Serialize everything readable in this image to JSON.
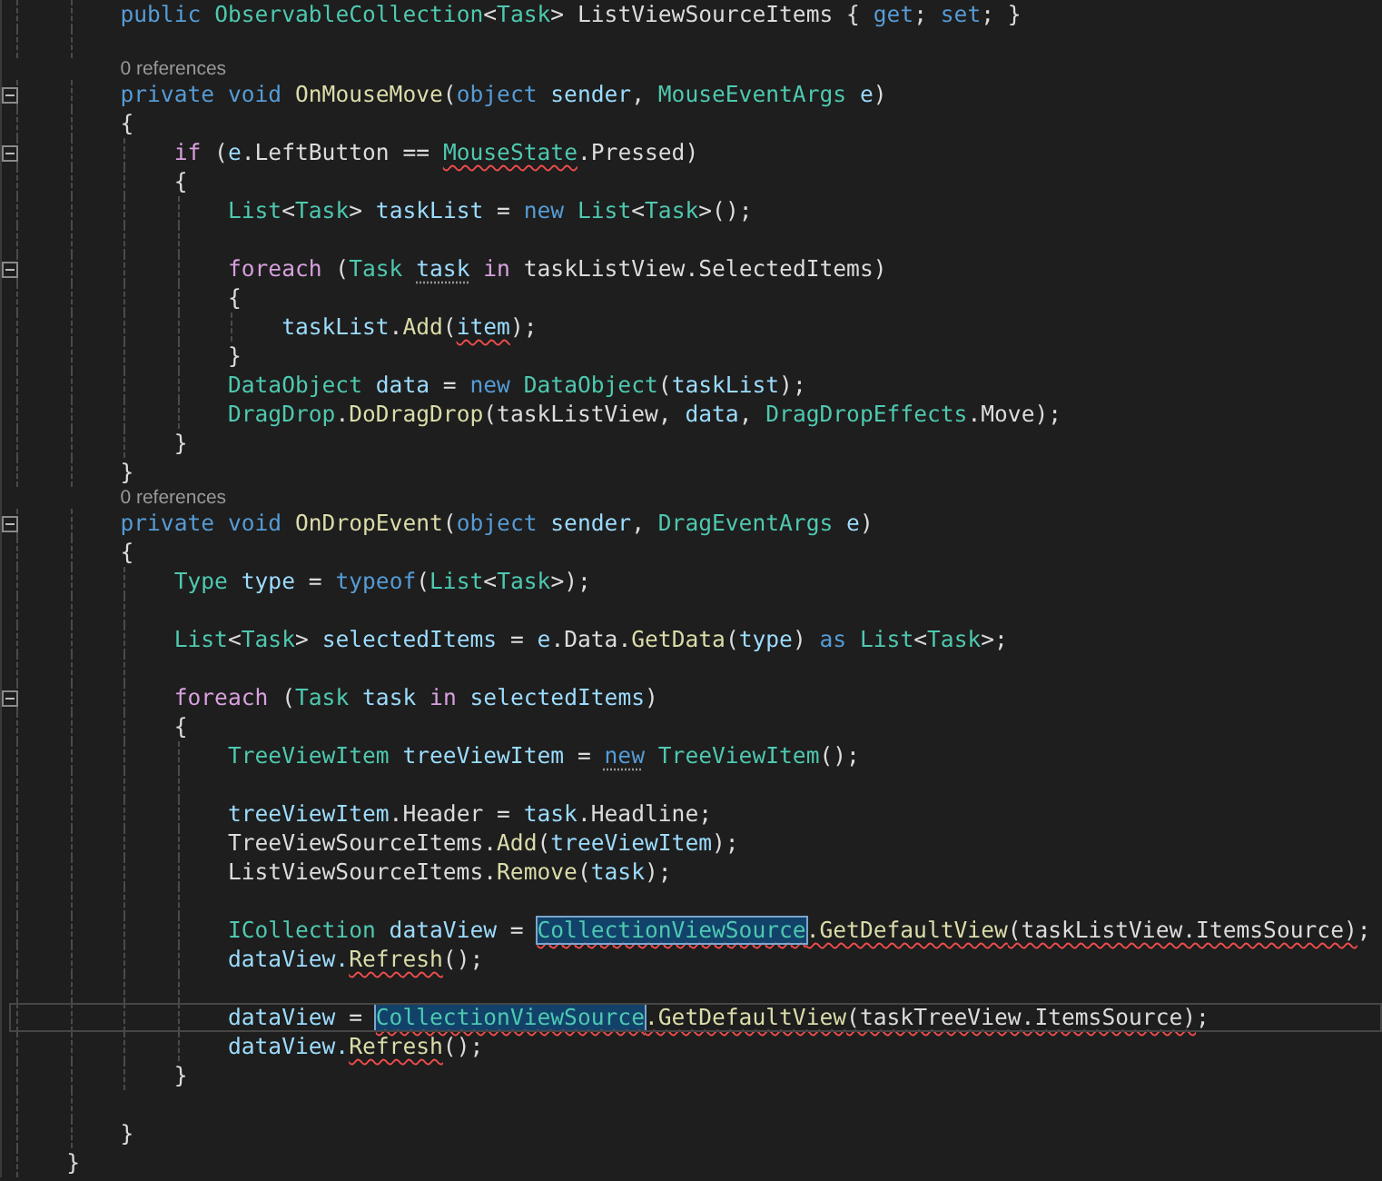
{
  "editor": {
    "lines": [
      {
        "kind": "code",
        "fold": false,
        "current": false,
        "tokens": [
          {
            "text": "        public ",
            "kind": "keyword"
          },
          {
            "text": "ObservableCollection",
            "kind": "type"
          },
          {
            "text": "<",
            "kind": "plain"
          },
          {
            "text": "Task",
            "kind": "type"
          },
          {
            "text": "> ListViewSourceItems { ",
            "kind": "plain"
          },
          {
            "text": "get",
            "kind": "keyword"
          },
          {
            "text": "; ",
            "kind": "plain"
          },
          {
            "text": "set",
            "kind": "keyword"
          },
          {
            "text": "; }",
            "kind": "plain"
          }
        ]
      },
      {
        "kind": "blank"
      },
      {
        "kind": "codelens",
        "text": "0 references"
      },
      {
        "kind": "code",
        "fold": true,
        "current": false,
        "tokens": [
          {
            "text": "        private void ",
            "kind": "keyword"
          },
          {
            "text": "OnMouseMove",
            "kind": "method"
          },
          {
            "text": "(",
            "kind": "plain"
          },
          {
            "text": "object ",
            "kind": "keyword"
          },
          {
            "text": "sender",
            "kind": "variable"
          },
          {
            "text": ", ",
            "kind": "plain"
          },
          {
            "text": "MouseEventArgs ",
            "kind": "type"
          },
          {
            "text": "e",
            "kind": "variable"
          },
          {
            "text": ")",
            "kind": "plain"
          }
        ]
      },
      {
        "kind": "code",
        "fold": false,
        "current": false,
        "tokens": [
          {
            "text": "        {",
            "kind": "plain"
          }
        ]
      },
      {
        "kind": "code",
        "fold": true,
        "current": false,
        "tokens": [
          {
            "text": "            if",
            "kind": "control"
          },
          {
            "text": " (",
            "kind": "plain"
          },
          {
            "text": "e",
            "kind": "variable"
          },
          {
            "text": ".LeftButton == ",
            "kind": "plain"
          },
          {
            "text": "MouseState",
            "kind": "type-error"
          },
          {
            "text": ".Pressed)",
            "kind": "plain"
          }
        ]
      },
      {
        "kind": "code",
        "fold": false,
        "current": false,
        "tokens": [
          {
            "text": "            {",
            "kind": "plain"
          }
        ]
      },
      {
        "kind": "code",
        "fold": false,
        "current": false,
        "tokens": [
          {
            "text": "                List",
            "kind": "type"
          },
          {
            "text": "<",
            "kind": "plain"
          },
          {
            "text": "Task",
            "kind": "type"
          },
          {
            "text": "> ",
            "kind": "plain"
          },
          {
            "text": "taskList",
            "kind": "variable"
          },
          {
            "text": " = ",
            "kind": "plain"
          },
          {
            "text": "new ",
            "kind": "keyword"
          },
          {
            "text": "List",
            "kind": "type"
          },
          {
            "text": "<",
            "kind": "plain"
          },
          {
            "text": "Task",
            "kind": "type"
          },
          {
            "text": ">();",
            "kind": "plain"
          }
        ]
      },
      {
        "kind": "blank"
      },
      {
        "kind": "code",
        "fold": true,
        "current": false,
        "tokens": [
          {
            "text": "                foreach",
            "kind": "control"
          },
          {
            "text": " (",
            "kind": "plain"
          },
          {
            "text": "Task ",
            "kind": "type"
          },
          {
            "text": "task",
            "kind": "variable-hint"
          },
          {
            "text": " in",
            "kind": "control"
          },
          {
            "text": " taskListView.SelectedItems)",
            "kind": "plain"
          }
        ]
      },
      {
        "kind": "code",
        "fold": false,
        "current": false,
        "tokens": [
          {
            "text": "                {",
            "kind": "plain"
          }
        ]
      },
      {
        "kind": "code",
        "fold": false,
        "current": false,
        "tokens": [
          {
            "text": "                    taskList",
            "kind": "variable"
          },
          {
            "text": ".",
            "kind": "plain"
          },
          {
            "text": "Add",
            "kind": "method"
          },
          {
            "text": "(",
            "kind": "plain"
          },
          {
            "text": "item",
            "kind": "variable-error"
          },
          {
            "text": ");",
            "kind": "plain"
          }
        ]
      },
      {
        "kind": "code",
        "fold": false,
        "current": false,
        "tokens": [
          {
            "text": "                }",
            "kind": "plain"
          }
        ]
      },
      {
        "kind": "code",
        "fold": false,
        "current": false,
        "tokens": [
          {
            "text": "                DataObject ",
            "kind": "type"
          },
          {
            "text": "data",
            "kind": "variable"
          },
          {
            "text": " = ",
            "kind": "plain"
          },
          {
            "text": "new ",
            "kind": "keyword"
          },
          {
            "text": "DataObject",
            "kind": "type"
          },
          {
            "text": "(",
            "kind": "plain"
          },
          {
            "text": "taskList",
            "kind": "variable"
          },
          {
            "text": ");",
            "kind": "plain"
          }
        ]
      },
      {
        "kind": "code",
        "fold": false,
        "current": false,
        "tokens": [
          {
            "text": "                DragDrop",
            "kind": "type"
          },
          {
            "text": ".",
            "kind": "plain"
          },
          {
            "text": "DoDragDrop",
            "kind": "method"
          },
          {
            "text": "(taskListView, ",
            "kind": "plain"
          },
          {
            "text": "data",
            "kind": "variable"
          },
          {
            "text": ", ",
            "kind": "plain"
          },
          {
            "text": "DragDropEffects",
            "kind": "type"
          },
          {
            "text": ".Move);",
            "kind": "plain"
          }
        ]
      },
      {
        "kind": "code",
        "fold": false,
        "current": false,
        "tokens": [
          {
            "text": "            }",
            "kind": "plain"
          }
        ]
      },
      {
        "kind": "code",
        "fold": false,
        "current": false,
        "tokens": [
          {
            "text": "        }",
            "kind": "plain"
          }
        ]
      },
      {
        "kind": "codelens",
        "text": "0 references"
      },
      {
        "kind": "code",
        "fold": true,
        "current": false,
        "tokens": [
          {
            "text": "        private void ",
            "kind": "keyword"
          },
          {
            "text": "OnDropEvent",
            "kind": "method"
          },
          {
            "text": "(",
            "kind": "plain"
          },
          {
            "text": "object ",
            "kind": "keyword"
          },
          {
            "text": "sender",
            "kind": "variable"
          },
          {
            "text": ", ",
            "kind": "plain"
          },
          {
            "text": "DragEventArgs ",
            "kind": "type"
          },
          {
            "text": "e",
            "kind": "variable"
          },
          {
            "text": ")",
            "kind": "plain"
          }
        ]
      },
      {
        "kind": "code",
        "fold": false,
        "current": false,
        "tokens": [
          {
            "text": "        {",
            "kind": "plain"
          }
        ]
      },
      {
        "kind": "code",
        "fold": false,
        "current": false,
        "tokens": [
          {
            "text": "            Type ",
            "kind": "type"
          },
          {
            "text": "type",
            "kind": "variable"
          },
          {
            "text": " = ",
            "kind": "plain"
          },
          {
            "text": "typeof",
            "kind": "keyword"
          },
          {
            "text": "(",
            "kind": "plain"
          },
          {
            "text": "List",
            "kind": "type"
          },
          {
            "text": "<",
            "kind": "plain"
          },
          {
            "text": "Task",
            "kind": "type"
          },
          {
            "text": ">);",
            "kind": "plain"
          }
        ]
      },
      {
        "kind": "blank"
      },
      {
        "kind": "code",
        "fold": false,
        "current": false,
        "tokens": [
          {
            "text": "            List",
            "kind": "type"
          },
          {
            "text": "<",
            "kind": "plain"
          },
          {
            "text": "Task",
            "kind": "type"
          },
          {
            "text": "> ",
            "kind": "plain"
          },
          {
            "text": "selectedItems",
            "kind": "variable"
          },
          {
            "text": " = ",
            "kind": "plain"
          },
          {
            "text": "e",
            "kind": "variable"
          },
          {
            "text": ".Data.",
            "kind": "plain"
          },
          {
            "text": "GetData",
            "kind": "method"
          },
          {
            "text": "(",
            "kind": "plain"
          },
          {
            "text": "type",
            "kind": "variable"
          },
          {
            "text": ") ",
            "kind": "plain"
          },
          {
            "text": "as ",
            "kind": "keyword"
          },
          {
            "text": "List",
            "kind": "type"
          },
          {
            "text": "<",
            "kind": "plain"
          },
          {
            "text": "Task",
            "kind": "type"
          },
          {
            "text": ">;",
            "kind": "plain"
          }
        ]
      },
      {
        "kind": "blank"
      },
      {
        "kind": "code",
        "fold": true,
        "current": false,
        "tokens": [
          {
            "text": "            foreach",
            "kind": "control"
          },
          {
            "text": " (",
            "kind": "plain"
          },
          {
            "text": "Task ",
            "kind": "type"
          },
          {
            "text": "task",
            "kind": "variable"
          },
          {
            "text": " in ",
            "kind": "control"
          },
          {
            "text": "selectedItems",
            "kind": "variable"
          },
          {
            "text": ")",
            "kind": "plain"
          }
        ]
      },
      {
        "kind": "code",
        "fold": false,
        "current": false,
        "tokens": [
          {
            "text": "            {",
            "kind": "plain"
          }
        ]
      },
      {
        "kind": "code",
        "fold": false,
        "current": false,
        "tokens": [
          {
            "text": "                TreeViewItem ",
            "kind": "type"
          },
          {
            "text": "treeViewItem",
            "kind": "variable"
          },
          {
            "text": " = ",
            "kind": "plain"
          },
          {
            "text": "new",
            "kind": "keyword-hint"
          },
          {
            "text": " TreeViewItem",
            "kind": "type"
          },
          {
            "text": "();",
            "kind": "plain"
          }
        ]
      },
      {
        "kind": "blank"
      },
      {
        "kind": "code",
        "fold": false,
        "current": false,
        "tokens": [
          {
            "text": "                treeViewItem",
            "kind": "variable"
          },
          {
            "text": ".Header = ",
            "kind": "plain"
          },
          {
            "text": "task",
            "kind": "variable"
          },
          {
            "text": ".Headline;",
            "kind": "plain"
          }
        ]
      },
      {
        "kind": "code",
        "fold": false,
        "current": false,
        "tokens": [
          {
            "text": "                TreeViewSourceItems.",
            "kind": "plain"
          },
          {
            "text": "Add",
            "kind": "method"
          },
          {
            "text": "(",
            "kind": "plain"
          },
          {
            "text": "treeViewItem",
            "kind": "variable"
          },
          {
            "text": ");",
            "kind": "plain"
          }
        ]
      },
      {
        "kind": "code",
        "fold": false,
        "current": false,
        "tokens": [
          {
            "text": "                ListViewSourceItems.",
            "kind": "plain"
          },
          {
            "text": "Remove",
            "kind": "method"
          },
          {
            "text": "(",
            "kind": "plain"
          },
          {
            "text": "task",
            "kind": "variable"
          },
          {
            "text": ");",
            "kind": "plain"
          }
        ]
      },
      {
        "kind": "blank"
      },
      {
        "kind": "code",
        "fold": false,
        "current": false,
        "tokens": [
          {
            "text": "                ICollection ",
            "kind": "type"
          },
          {
            "text": "dataView",
            "kind": "variable"
          },
          {
            "text": " = ",
            "kind": "plain"
          },
          {
            "text": "CollectionViewSource",
            "kind": "type-highlight-error"
          },
          {
            "text": ".GetDefaultView",
            "kind": "method-error"
          },
          {
            "text": "(taskListView.ItemsSource)",
            "kind": "plain-error"
          },
          {
            "text": ";",
            "kind": "plain"
          }
        ]
      },
      {
        "kind": "code",
        "fold": false,
        "current": false,
        "tokens": [
          {
            "text": "                dataView.",
            "kind": "variable"
          },
          {
            "text": "Refresh",
            "kind": "method-error"
          },
          {
            "text": "();",
            "kind": "plain"
          }
        ]
      },
      {
        "kind": "blank"
      },
      {
        "kind": "code",
        "fold": false,
        "current": true,
        "tokens": [
          {
            "text": "                dataView",
            "kind": "variable"
          },
          {
            "text": " = ",
            "kind": "plain"
          },
          {
            "text": "CollectionViewSource",
            "kind": "type-highlight-error"
          },
          {
            "text": ".GetDefaultView",
            "kind": "method-error"
          },
          {
            "text": "(taskTreeView.ItemsSource)",
            "kind": "plain-error"
          },
          {
            "text": ";",
            "kind": "plain"
          }
        ]
      },
      {
        "kind": "code",
        "fold": false,
        "current": false,
        "tokens": [
          {
            "text": "                dataView.",
            "kind": "variable"
          },
          {
            "text": "Refresh",
            "kind": "method-error"
          },
          {
            "text": "();",
            "kind": "plain"
          }
        ]
      },
      {
        "kind": "code",
        "fold": false,
        "current": false,
        "tokens": [
          {
            "text": "            }",
            "kind": "plain"
          }
        ]
      },
      {
        "kind": "blank"
      },
      {
        "kind": "code",
        "fold": false,
        "current": false,
        "tokens": [
          {
            "text": "        }",
            "kind": "plain"
          }
        ]
      },
      {
        "kind": "code",
        "fold": false,
        "current": false,
        "tokens": [
          {
            "text": "    }",
            "kind": "plain"
          }
        ]
      }
    ]
  }
}
